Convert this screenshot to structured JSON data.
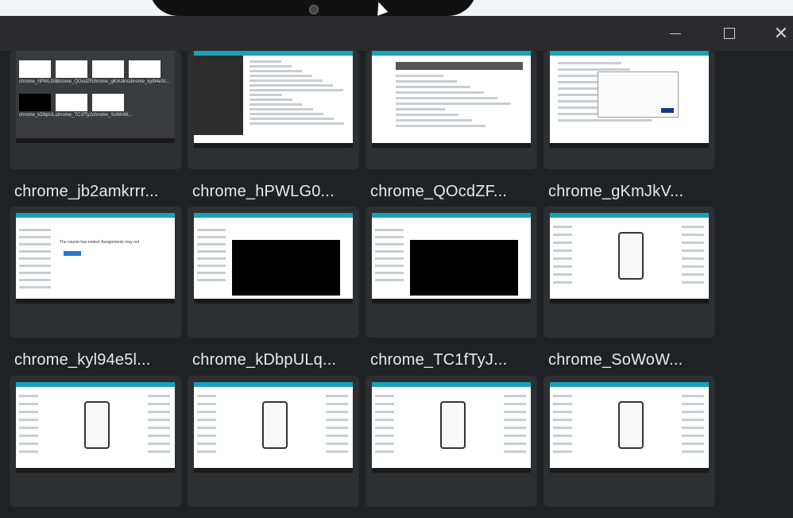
{
  "window": {
    "minimize_icon": "minimize-icon",
    "maximize_icon": "maximize-icon",
    "close_icon": "close-icon",
    "close_glyph": "✕"
  },
  "thumbnails": [
    {
      "label": "chrome_jb2amkrrr...",
      "kind": "grid",
      "sub_labels": [
        "chrome_hPWLG0...",
        "chrome_QOcdZF...",
        "chrome_gKmJkV...",
        "chrome_kyl94eSI...",
        "chrome_kDbpUL...",
        "chrome_TC1fTyJ...",
        "chrome_SoWoW..."
      ]
    },
    {
      "label": "chrome_hPWLG0...",
      "kind": "editor"
    },
    {
      "label": "chrome_QOcdZF...",
      "kind": "course"
    },
    {
      "label": "chrome_gKmJkV...",
      "kind": "dialog"
    },
    {
      "label": "chrome_kyl94e5l...",
      "kind": "coursera",
      "header_text": "The course has ended. Assignments may not"
    },
    {
      "label": "chrome_kDbpULq...",
      "kind": "video"
    },
    {
      "label": "chrome_TC1fTyJ...",
      "kind": "slide"
    },
    {
      "label": "chrome_SoWoW...",
      "kind": "phone"
    },
    {
      "label": "",
      "kind": "phone"
    },
    {
      "label": "",
      "kind": "phone"
    },
    {
      "label": "",
      "kind": "phone"
    },
    {
      "label": "",
      "kind": "phone"
    }
  ]
}
